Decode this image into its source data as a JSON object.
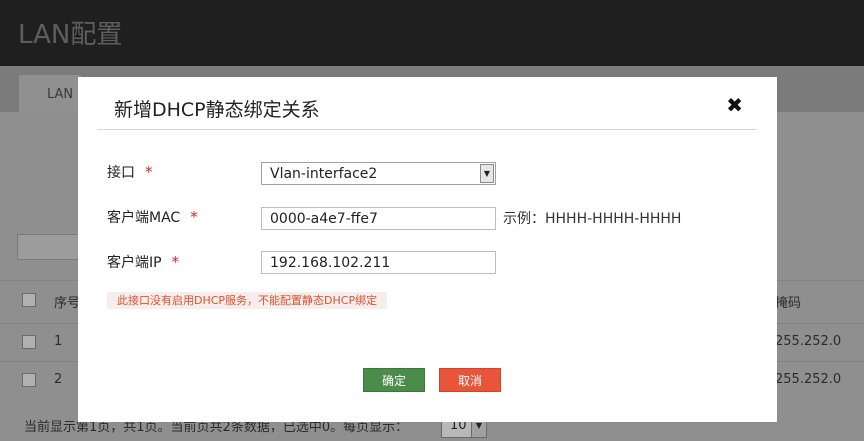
{
  "background": {
    "page_title": "LAN配置",
    "tab_label": "LAN",
    "table_header_seq": "序号",
    "table_header_mask": "掩码",
    "rows": [
      {
        "seq": "1",
        "mask": "255.252.0"
      },
      {
        "seq": "2",
        "mask": "255.252.0"
      }
    ],
    "footer_text": "当前显示第1页，共1页。当前页共2条数据，已选中0。每页显示：",
    "page_size": "10"
  },
  "modal": {
    "title": "新增DHCP静态绑定关系",
    "close_icon": "✖",
    "interface_label": "接口",
    "interface_value": "Vlan-interface2",
    "mac_label": "客户端MAC",
    "mac_value": "0000-a4e7-ffe7",
    "mac_hint": "示例：HHHH-HHHH-HHHH",
    "ip_label": "客户端IP",
    "ip_value": "192.168.102.211",
    "required_mark": "*",
    "warning": "此接口没有启用DHCP服务，不能配置静态DHCP绑定",
    "ok_label": "确定",
    "cancel_label": "取消"
  },
  "colors": {
    "ok": "#4a8c4a",
    "cancel": "#e8553a",
    "required": "#e02222",
    "warning_text": "#e2502f"
  }
}
